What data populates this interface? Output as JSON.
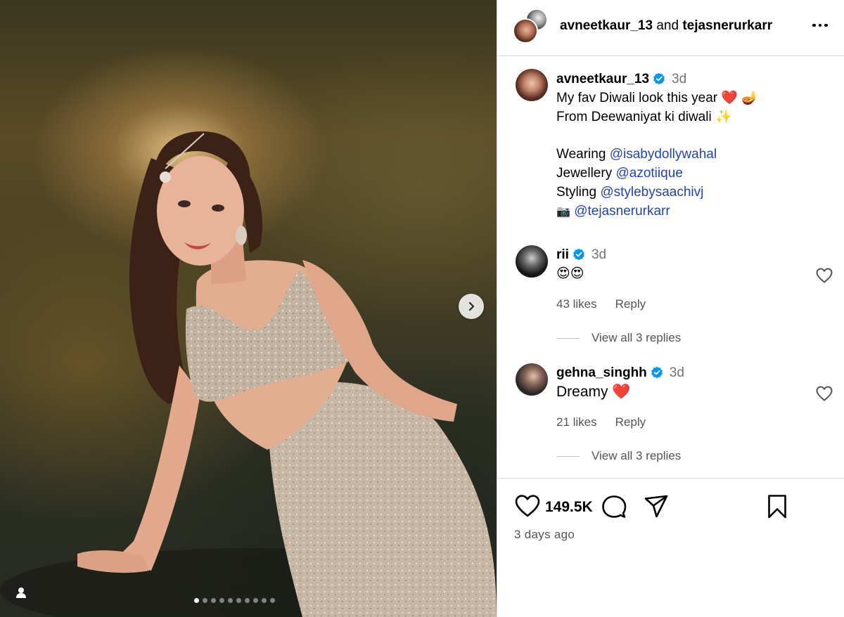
{
  "post": {
    "carousel": {
      "slide_count": 10,
      "active_slide": 1
    },
    "header": {
      "user1": "avneetkaur_13",
      "joiner": "and",
      "user2": "tejasnerurkarr"
    },
    "caption": {
      "username": "avneetkaur_13",
      "time": "3d",
      "line1": "My fav Diwali look this year",
      "line2": "From Deewaniyat ki diwali",
      "wearing_label": "Wearing",
      "wearing_mention": "@isabydollywahal",
      "jewellery_label": "Jewellery",
      "jewellery_mention": "@azotiique",
      "styling_label": "Styling",
      "styling_mention": "@stylebysaachivj",
      "camera_mention": "@tejasnerurkarr",
      "emoji1": "❤️",
      "emoji2": "🪔",
      "emoji3": "✨",
      "camera_emoji": "📷"
    },
    "comments": [
      {
        "username": "rii",
        "time": "3d",
        "text": "😍😍",
        "likes": "43 likes",
        "reply_label": "Reply",
        "view_replies": "View all 3 replies"
      },
      {
        "username": "gehna_singhh",
        "time": "3d",
        "text": "Dreamy",
        "emoji": "❤️",
        "likes": "21 likes",
        "reply_label": "Reply",
        "view_replies": "View all 3 replies"
      }
    ],
    "like_count": "149.5K",
    "posted_ago": "3 days ago"
  },
  "colors": {
    "mention": "#2443b6",
    "verified": "#0095f6",
    "heart_emoji": "#e0245e",
    "muted": "#737373",
    "divider": "#dbdbdb"
  },
  "icons": [
    "chevron-right-icon",
    "user-tag-icon",
    "more-icon",
    "verified-icon",
    "heart-icon",
    "comment-icon",
    "share-icon",
    "bookmark-icon"
  ]
}
